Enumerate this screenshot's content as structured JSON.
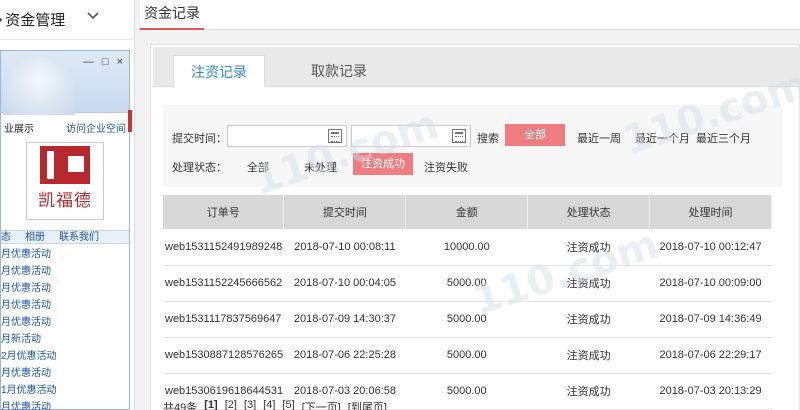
{
  "sidebar": {
    "bullet": "•",
    "title": "资金管理",
    "widget": {
      "controls": [
        "—",
        "□",
        "×"
      ],
      "bar_left": "业展示",
      "bar_right": "访问企业空间",
      "logo_text": "凯福德",
      "tabs": [
        "态",
        "相册",
        "联系我们"
      ],
      "links": [
        "月优惠活动",
        "月优惠活动",
        "月优惠活动",
        "月优惠活动",
        "月优惠活动",
        "月新活动",
        "2月优惠活动",
        "月优惠活动",
        "1月优惠活动",
        "月优惠活动"
      ]
    }
  },
  "header": {
    "tab_label": "资金记录"
  },
  "panel": {
    "tabs": [
      "注资记录",
      "取款记录"
    ],
    "filter": {
      "time_label": "提交时间：",
      "search_label": "搜索",
      "all_label": "全部",
      "range_week": "最近一周",
      "range_month": "最近一个月",
      "range_3month": "最近三个月",
      "status_label": "处理状态：",
      "status_all": "全部",
      "status_pending": "未处理",
      "status_success": "注资成功",
      "status_fail": "注资失败"
    },
    "table": {
      "headers": [
        "订单号",
        "提交时间",
        "金额",
        "处理状态",
        "处理时间"
      ],
      "rows": [
        [
          "web1531152491989248",
          "2018-07-10 00:08:11",
          "10000.00",
          "注资成功",
          "2018-07-10 00:12:47"
        ],
        [
          "web1531152245666562",
          "2018-07-10 00:04:05",
          "5000.00",
          "注资成功",
          "2018-07-10 00:09:00"
        ],
        [
          "web1531117837569647",
          "2018-07-09 14:30:37",
          "5000.00",
          "注资成功",
          "2018-07-09 14:36:49"
        ],
        [
          "web1530887128576265",
          "2018-07-06 22:25:28",
          "5000.00",
          "注资成功",
          "2018-07-06 22:29:17"
        ],
        [
          "web1530619618644531",
          "2018-07-03 20:06:58",
          "5000.00",
          "注资成功",
          "2018-07-03 20:13:29"
        ]
      ]
    },
    "pager": {
      "total": "共49条",
      "pages": [
        "[1]",
        "[2]",
        "[3]",
        "[4]",
        "[5]"
      ],
      "next": "[下一页]",
      "last": "[到尾页]"
    }
  },
  "watermark": "110.com",
  "colors": {
    "accent_red": "#ef7d7f",
    "tab_blue": "#2a8fc9",
    "underline": "#e0575c"
  }
}
